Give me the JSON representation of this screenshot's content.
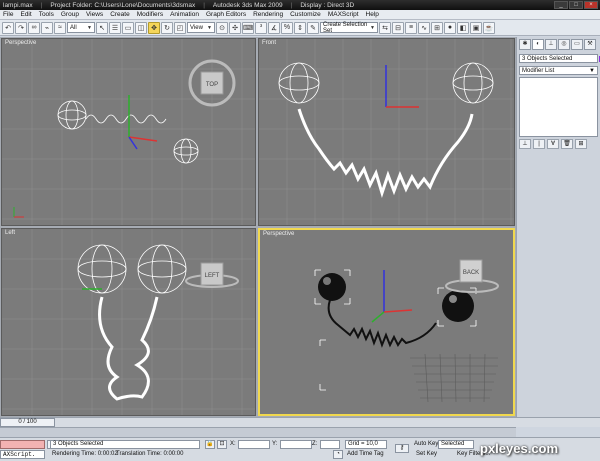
{
  "window": {
    "file": "lampi.max",
    "project_folder": "Project Folder: C:\\Users\\Lone\\Documents\\3dsmax",
    "app": "Autodesk 3ds Max 2009",
    "display": "Display : Direct 3D"
  },
  "menu": [
    "File",
    "Edit",
    "Tools",
    "Group",
    "Views",
    "Create",
    "Modifiers",
    "Animation",
    "Graph Editors",
    "Rendering",
    "Customize",
    "MAXScript",
    "Help"
  ],
  "toolbar": {
    "filter_value": "All",
    "refcoord_value": "View",
    "selection_set_placeholder": "Create Selection Set"
  },
  "viewports": {
    "top_left": {
      "label": "Perspective",
      "cube_label": "TOP"
    },
    "top_right": {
      "label": "Front"
    },
    "bottom_left": {
      "label": "Left",
      "cube_label": "LEFT"
    },
    "bottom_right": {
      "label": "Perspective",
      "cube_label": "BACK"
    }
  },
  "command_panel": {
    "object_name": "3 Objects Selected",
    "modifier_list": "Modifier List",
    "swatch_color": "#8a2be2"
  },
  "timeline": {
    "frame": "0 / 100"
  },
  "status": {
    "selection": "3 Objects Selected",
    "render_time": "Rendering Time: 0:00:02",
    "translation_time": "Translation Time: 0:00:00",
    "x_label": "X:",
    "y_label": "Y:",
    "z_label": "Z:",
    "grid": "Grid = 10,0",
    "add_time_tag": "Add Time Tag",
    "auto_key": "Auto Key",
    "set_key": "Set Key",
    "key_mode": "Selected",
    "key_filters": "Key Filters...",
    "maxscript_label": "AXScript."
  },
  "watermark": "pxleyes.com"
}
